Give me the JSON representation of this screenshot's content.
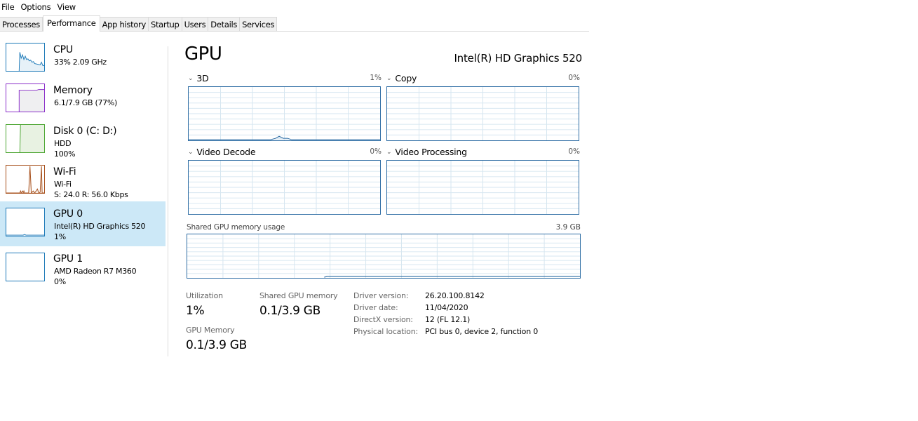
{
  "menu": [
    "File",
    "Options",
    "View"
  ],
  "tabs": [
    {
      "label": "Processes",
      "active": false
    },
    {
      "label": "Performance",
      "active": true
    },
    {
      "label": "App history",
      "active": false
    },
    {
      "label": "Startup",
      "active": false
    },
    {
      "label": "Users",
      "active": false
    },
    {
      "label": "Details",
      "active": false
    },
    {
      "label": "Services",
      "active": false
    }
  ],
  "sidebar": {
    "items": [
      {
        "title": "CPU",
        "line1": "33% 2.09 GHz",
        "line2": "",
        "color": "#1e7ab8",
        "selected": false,
        "icon": "cpu-graph-icon"
      },
      {
        "title": "Memory",
        "line1": "6.1/7.9 GB (77%)",
        "line2": "",
        "color": "#8b2fc9",
        "selected": false,
        "icon": "memory-graph-icon"
      },
      {
        "title": "Disk 0 (C: D:)",
        "line1": "HDD",
        "line2": "100%",
        "color": "#4da633",
        "selected": false,
        "icon": "disk-graph-icon"
      },
      {
        "title": "Wi-Fi",
        "line1": "Wi-Fi",
        "line2": "S: 24.0  R: 56.0 Kbps",
        "color": "#a7501c",
        "selected": false,
        "icon": "wifi-graph-icon"
      },
      {
        "title": "GPU 0",
        "line1": "Intel(R) HD Graphics 520",
        "line2": "1%",
        "color": "#1e7ab8",
        "selected": true,
        "icon": "gpu0-graph-icon"
      },
      {
        "title": "GPU 1",
        "line1": "AMD Radeon R7 M360",
        "line2": "0%",
        "color": "#1e7ab8",
        "selected": false,
        "icon": "gpu1-graph-icon"
      }
    ]
  },
  "main": {
    "title": "GPU",
    "device": "Intel(R) HD Graphics 520",
    "accent": "#2e6da4",
    "engines": [
      {
        "label": "3D",
        "percent": "1%"
      },
      {
        "label": "Copy",
        "percent": "0%"
      },
      {
        "label": "Video Decode",
        "percent": "0%"
      },
      {
        "label": "Video Processing",
        "percent": "0%"
      }
    ],
    "shared_memory": {
      "label": "Shared GPU memory usage",
      "max": "3.9 GB"
    },
    "stats": {
      "utilization_label": "Utilization",
      "utilization_value": "1%",
      "shared_label": "Shared GPU memory",
      "shared_value": "0.1/3.9 GB",
      "gpu_memory_label": "GPU Memory",
      "gpu_memory_value": "0.1/3.9 GB"
    },
    "info": [
      {
        "key": "Driver version:",
        "value": "26.20.100.8142"
      },
      {
        "key": "Driver date:",
        "value": "11/04/2020"
      },
      {
        "key": "DirectX version:",
        "value": "12 (FL 12.1)"
      },
      {
        "key": "Physical location:",
        "value": "PCI bus 0, device 2, function 0"
      }
    ]
  }
}
